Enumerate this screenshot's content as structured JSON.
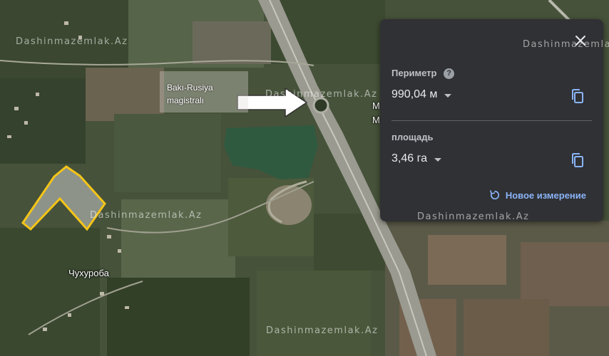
{
  "map": {
    "watermark": "Dashinmazemlak.Az",
    "village_label": "Чухуроба",
    "annotation": {
      "line1": "Bakı-Rusiya",
      "line2": "magistralı"
    },
    "road_fragment": "M",
    "colors": {
      "parcel_outline": "#f5c518",
      "water": "#2f5a40",
      "road": "#9a9a90"
    }
  },
  "measure_panel": {
    "perimeter": {
      "label": "Периметр",
      "value": "990,04 м",
      "help_icon": "help-icon",
      "copy_icon": "copy-icon"
    },
    "area": {
      "label": "площадь",
      "value": "3,46 га",
      "copy_icon": "copy-icon"
    },
    "close_icon": "close-icon",
    "new_measurement": {
      "label": "Новое измерение",
      "icon": "restart-icon"
    },
    "colors": {
      "background": "#303134",
      "accent": "#8ab4f8",
      "text": "#e8eaed"
    }
  }
}
